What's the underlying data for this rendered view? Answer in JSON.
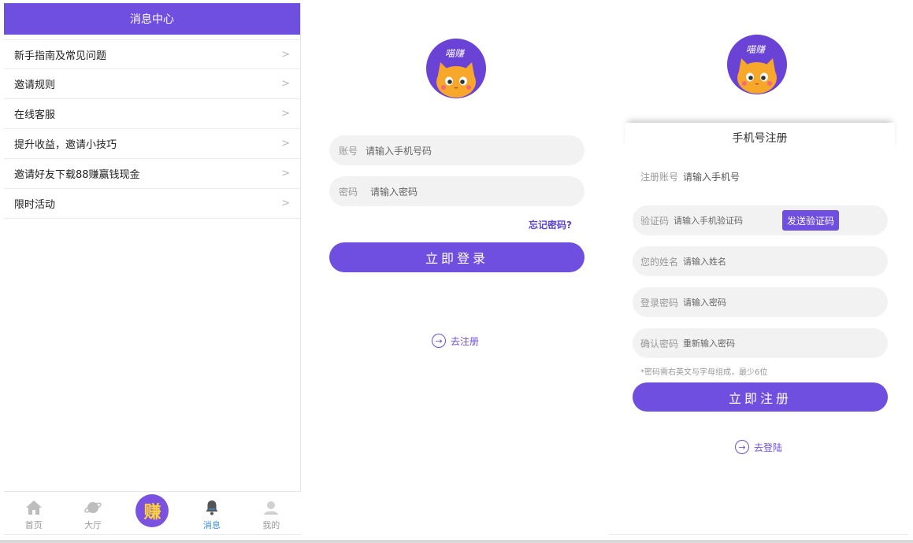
{
  "message_center": {
    "title": "消息中心",
    "items": [
      {
        "label": "新手指南及常见问题"
      },
      {
        "label": "邀请规则"
      },
      {
        "label": "在线客服"
      },
      {
        "label": "提升收益，邀请小技巧"
      },
      {
        "label": "邀请好友下载88赚赢钱现金"
      },
      {
        "label": "限时活动"
      }
    ],
    "chevron": ">",
    "tabbar": {
      "home": "首页",
      "hall": "大厅",
      "earn": "赚",
      "messages": "消息",
      "mine": "我的"
    }
  },
  "login": {
    "logo_text": "喵赚",
    "account_label": "账号",
    "account_placeholder": "请输入手机号码",
    "password_label": "密码",
    "password_placeholder": "请输入密码",
    "forgot": "忘记密码?",
    "submit": "立即登录",
    "to_register": "去注册"
  },
  "register": {
    "logo_text": "喵赚",
    "title": "手机号注册",
    "account_label": "注册账号",
    "account_placeholder": "请输入手机号",
    "code_label": "验证码",
    "code_placeholder": "请输入手机验证码",
    "send_code": "发送验证码",
    "name_label": "您的姓名",
    "name_placeholder": "请输入姓名",
    "password_label": "登录密码",
    "password_placeholder": "请输入密码",
    "confirm_label": "确认密码",
    "confirm_placeholder": "重新输入密码",
    "hint": "*密码需右英文与字母组成，最少6位",
    "submit": "立即注册",
    "to_login": "去登陆"
  },
  "colors": {
    "accent": "#6e4fe0",
    "active_tab": "#3a8ee6"
  }
}
